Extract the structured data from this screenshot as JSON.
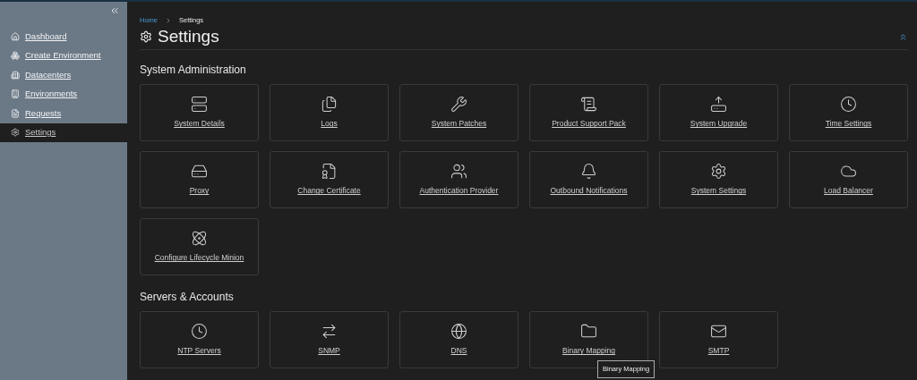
{
  "sidebar": {
    "items": [
      {
        "label": "Dashboard",
        "selected": false
      },
      {
        "label": "Create Environment",
        "selected": false
      },
      {
        "label": "Datacenters",
        "selected": false
      },
      {
        "label": "Environments",
        "selected": false
      },
      {
        "label": "Requests",
        "selected": false
      },
      {
        "label": "Settings",
        "selected": true
      }
    ]
  },
  "breadcrumb": [
    "Home",
    "Settings"
  ],
  "page_title": "Settings",
  "sections": [
    {
      "title": "System Administration",
      "tiles": [
        {
          "label": "System Details"
        },
        {
          "label": "Logs"
        },
        {
          "label": "System Patches"
        },
        {
          "label": "Product Support Pack"
        },
        {
          "label": "System Upgrade"
        },
        {
          "label": "Time Settings"
        },
        {
          "label": "Proxy"
        },
        {
          "label": "Change Certificate"
        },
        {
          "label": "Authentication Provider"
        },
        {
          "label": "Outbound Notifications"
        },
        {
          "label": "System Settings"
        },
        {
          "label": "Load Balancer"
        },
        {
          "label": "Configure Lifecycle Minion"
        }
      ]
    },
    {
      "title": "Servers & Accounts",
      "tiles": [
        {
          "label": "NTP Servers"
        },
        {
          "label": "SNMP"
        },
        {
          "label": "DNS"
        },
        {
          "label": "Binary Mapping",
          "tooltip": "Binary Mapping"
        },
        {
          "label": "SMTP"
        }
      ]
    }
  ]
}
